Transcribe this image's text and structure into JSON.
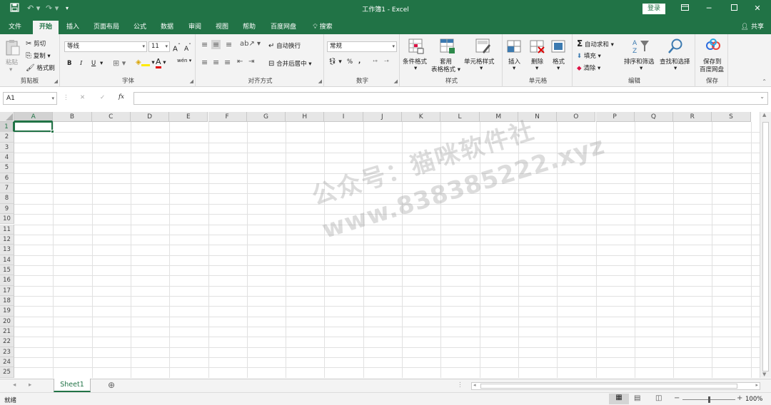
{
  "titlebar": {
    "title": "工作簿1  -  Excel",
    "login": "登录",
    "save_icon": "save-icon",
    "undo_icon": "undo-icon",
    "redo_icon": "redo-icon"
  },
  "tabs": [
    {
      "label": "文件"
    },
    {
      "label": "开始"
    },
    {
      "label": "插入"
    },
    {
      "label": "页面布局"
    },
    {
      "label": "公式"
    },
    {
      "label": "数据"
    },
    {
      "label": "审阅"
    },
    {
      "label": "视图"
    },
    {
      "label": "帮助"
    },
    {
      "label": "百度网盘"
    },
    {
      "label": "搜索"
    }
  ],
  "share": "共享",
  "ribbon": {
    "clipboard": {
      "label": "剪贴板",
      "paste": "粘贴",
      "cut": "剪切",
      "copy": "复制",
      "format_painter": "格式刷"
    },
    "font": {
      "label": "字体",
      "font_name": "等线",
      "font_size": "11",
      "bold": "B",
      "italic": "I",
      "underline": "U",
      "font_color_glyph": "A",
      "phonetic": "wén"
    },
    "alignment": {
      "label": "对齐方式",
      "wrap": "自动换行",
      "merge": "合并后居中"
    },
    "number": {
      "label": "数字",
      "format": "常规",
      "percent": "%",
      "comma": ","
    },
    "styles": {
      "label": "样式",
      "conditional": "条件格式",
      "table_1": "套用",
      "table_2": "表格格式",
      "cell_styles": "单元格样式"
    },
    "cells": {
      "label": "单元格",
      "insert": "插入",
      "delete": "删除",
      "format": "格式"
    },
    "editing": {
      "label": "编辑",
      "autosum": "自动求和",
      "fill": "填充",
      "clear": "清除",
      "sort": "排序和筛选",
      "find": "查找和选择"
    },
    "save": {
      "label": "保存",
      "btn_1": "保存到",
      "btn_2": "百度网盘"
    }
  },
  "formula_bar": {
    "name_box": "A1",
    "fx": "fx",
    "cancel": "✕",
    "confirm": "✓"
  },
  "grid": {
    "columns": [
      "A",
      "B",
      "C",
      "D",
      "E",
      "F",
      "G",
      "H",
      "I",
      "J",
      "K",
      "L",
      "M",
      "N",
      "O",
      "P",
      "Q",
      "R",
      "S"
    ],
    "rows": [
      "1",
      "2",
      "3",
      "4",
      "5",
      "6",
      "7",
      "8",
      "9",
      "10",
      "11",
      "12",
      "13",
      "14",
      "15",
      "16",
      "17",
      "18",
      "19",
      "20",
      "21",
      "22",
      "23",
      "24",
      "25"
    ],
    "selected_cell": "A1"
  },
  "sheets": [
    {
      "label": "Sheet1"
    }
  ],
  "status": {
    "ready": "就绪",
    "zoom": "100%"
  },
  "watermark": {
    "line1": "公众号：猫咪软件社",
    "line2": "www.838385222.xyz"
  },
  "colors": {
    "accent": "#217346",
    "ribbon_bg": "#f3f3f3",
    "gridline": "#e1e1e1"
  }
}
